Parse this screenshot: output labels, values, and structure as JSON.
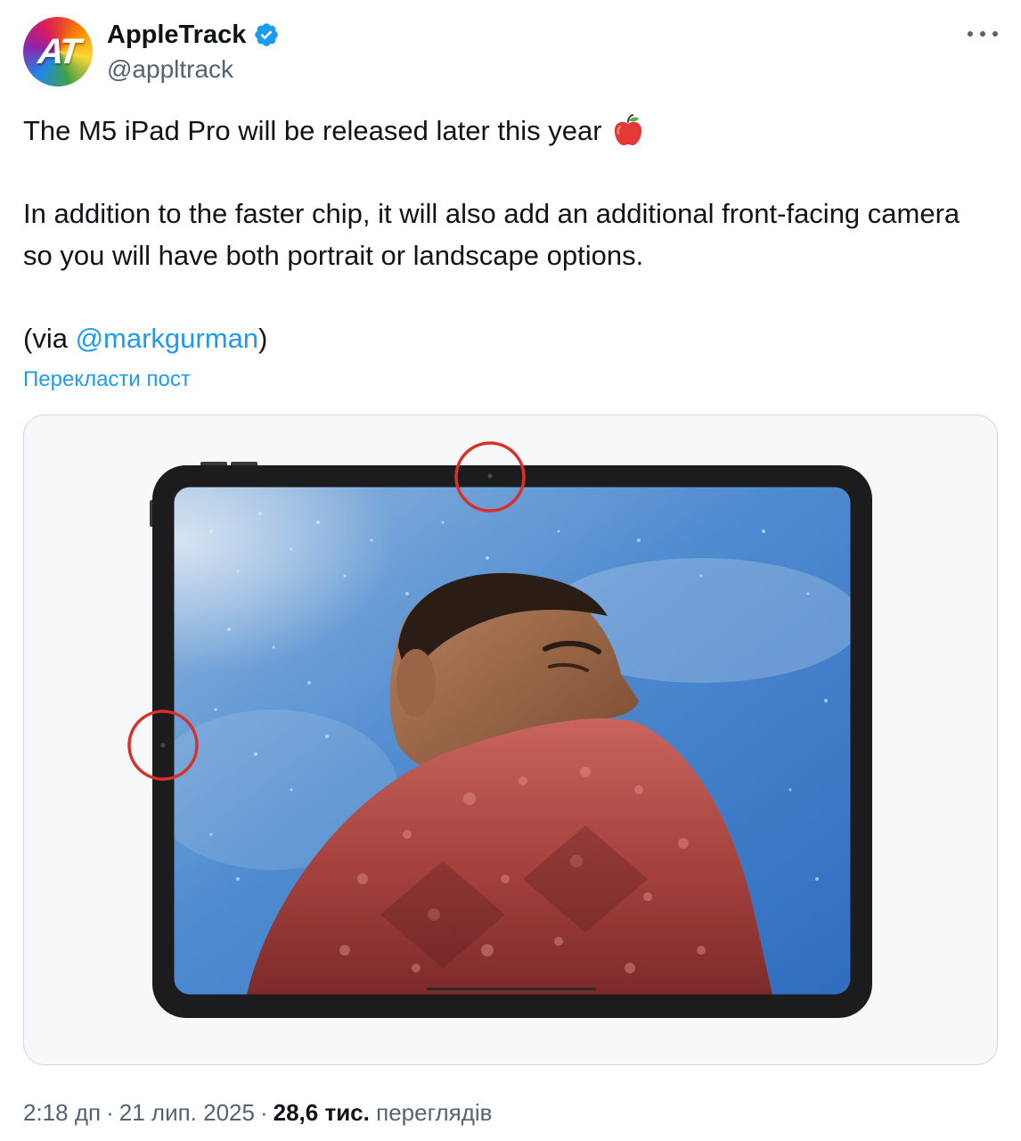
{
  "author": {
    "avatar_text": "AT",
    "display_name": "AppleTrack",
    "handle": "@appltrack",
    "verified": true
  },
  "tweet": {
    "line1": "The M5 iPad Pro will be released later this year",
    "emoji": "red-apple",
    "line2": "In addition to the faster chip, it will also add an additional front-facing camera so you will have both portrait or landscape options.",
    "via_prefix": "(via ",
    "mention": "@markgurman",
    "via_suffix": ")"
  },
  "translate_label": "Перекласти пост",
  "media": {
    "description_icon": "ipad-photo",
    "highlight_color": "#d9302a"
  },
  "meta": {
    "time": "2:18 дп",
    "date": "21 лип. 2025",
    "separator": "·",
    "views_count": "28,6 тис.",
    "views_label": "переглядів"
  },
  "colors": {
    "link": "#1d9bf0",
    "secondary_text": "#536471",
    "primary_text": "#0f1419",
    "verified": "#1d9bf0"
  }
}
